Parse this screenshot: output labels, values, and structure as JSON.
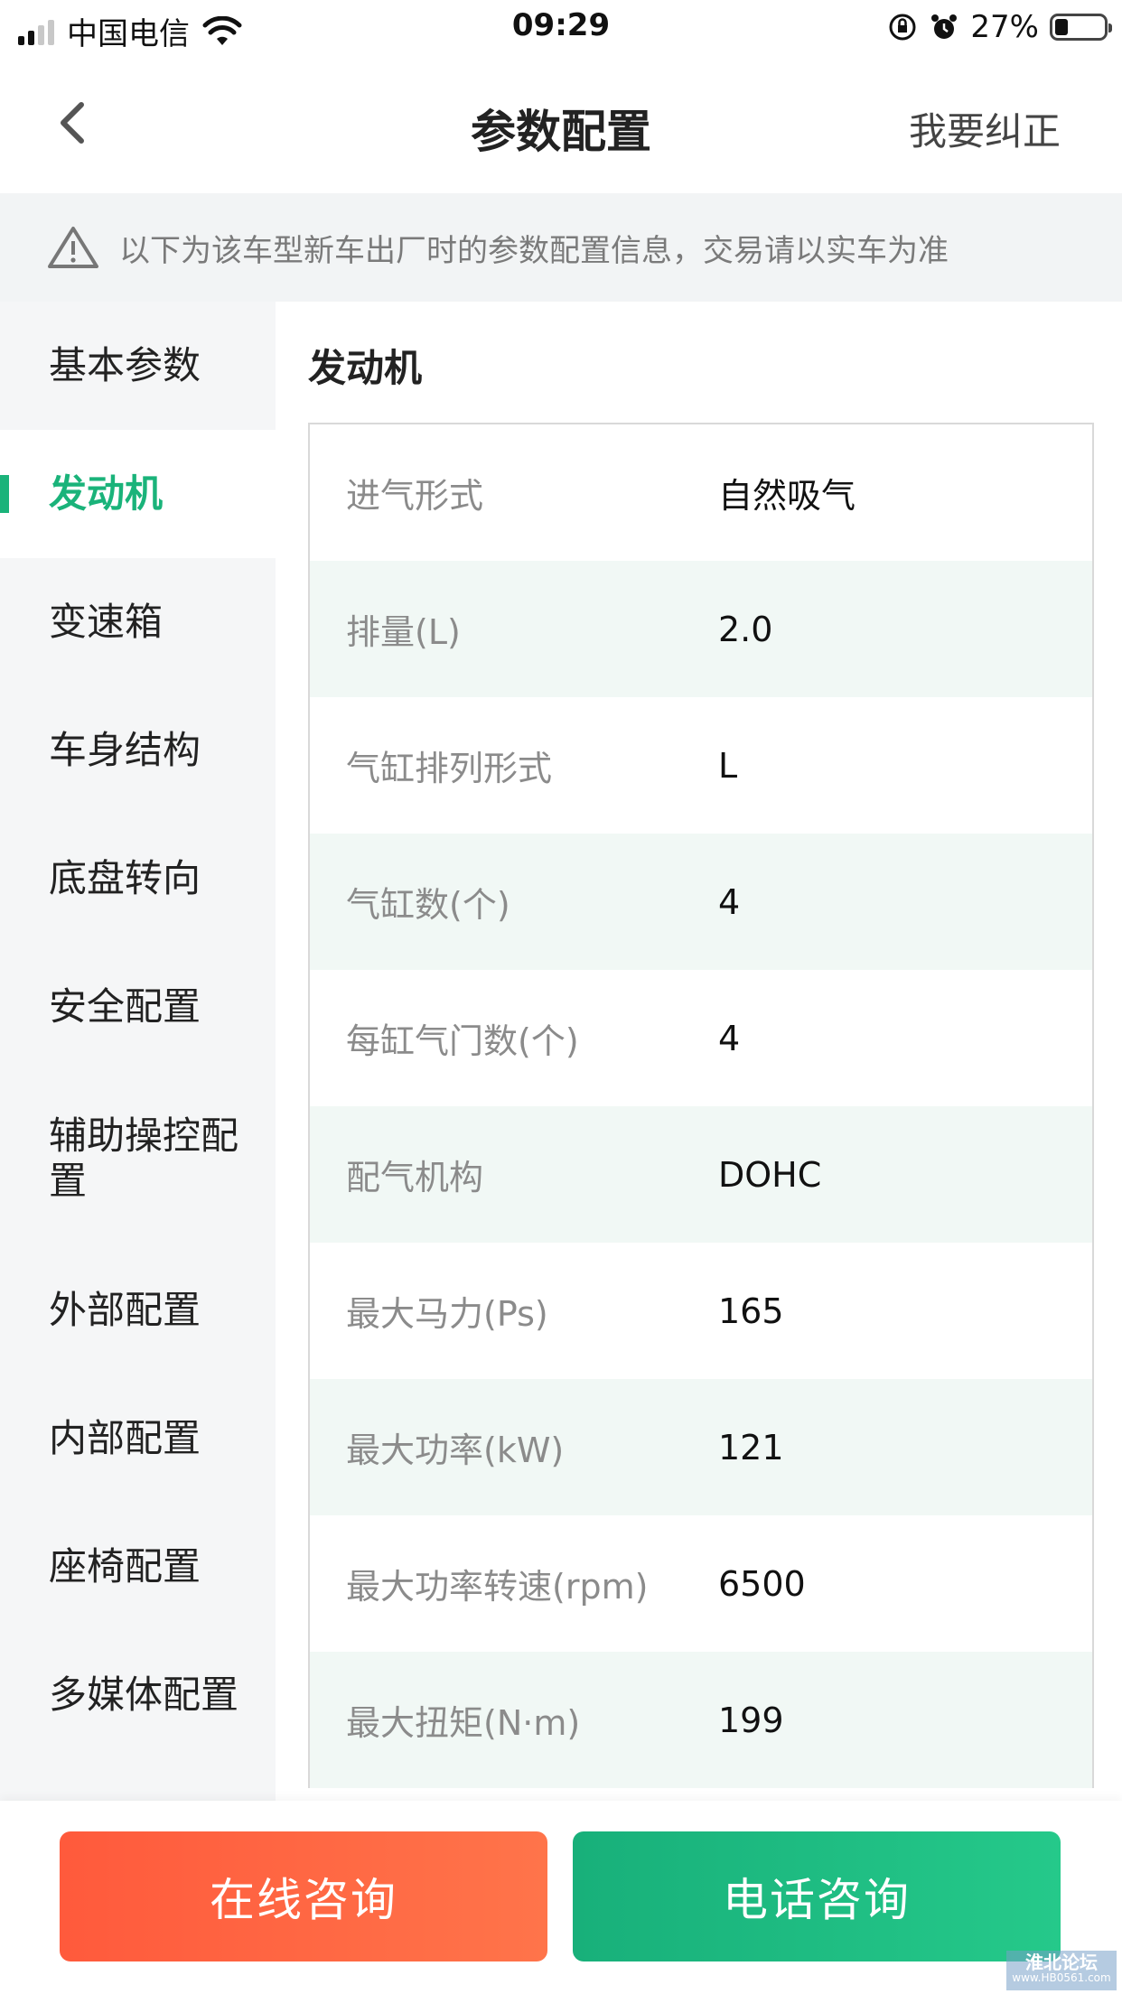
{
  "status_bar": {
    "carrier": "中国电信",
    "time": "09:29",
    "battery_percent": "27%",
    "battery_level": 0.27
  },
  "nav": {
    "title": "参数配置",
    "right_action": "我要纠正",
    "back_icon": "chevron-left-icon"
  },
  "notice": {
    "icon": "warning-triangle-icon",
    "text": "以下为该车型新车出厂时的参数配置信息，交易请以实车为准"
  },
  "sidebar": {
    "items": [
      {
        "label": "基本参数"
      },
      {
        "label": "发动机"
      },
      {
        "label": "变速箱"
      },
      {
        "label": "车身结构"
      },
      {
        "label": "底盘转向"
      },
      {
        "label": "安全配置"
      },
      {
        "label": "辅助操控配置"
      },
      {
        "label": "外部配置"
      },
      {
        "label": "内部配置"
      },
      {
        "label": "座椅配置"
      },
      {
        "label": "多媒体配置"
      }
    ],
    "active_index": 1,
    "accent_color": "#1ab37a"
  },
  "section": {
    "title": "发动机",
    "rows": [
      {
        "key": "进气形式",
        "value": "自然吸气"
      },
      {
        "key": "排量(L)",
        "value": "2.0"
      },
      {
        "key": "气缸排列形式",
        "value": "L"
      },
      {
        "key": "气缸数(个)",
        "value": "4"
      },
      {
        "key": "每缸气门数(个)",
        "value": "4"
      },
      {
        "key": "配气机构",
        "value": "DOHC"
      },
      {
        "key": "最大马力(Ps)",
        "value": "165"
      },
      {
        "key": "最大功率(kW)",
        "value": "121"
      },
      {
        "key": "最大功率转速(rpm)",
        "value": "6500"
      },
      {
        "key": "最大扭矩(N·m)",
        "value": "199"
      }
    ]
  },
  "bottom": {
    "online_label": "在线咨询",
    "phone_label": "电话咨询",
    "online_color": "#ff5a3c",
    "phone_color": "#18b07a"
  },
  "watermark": {
    "title": "淮北论坛",
    "url": "www.HB0561.com"
  }
}
